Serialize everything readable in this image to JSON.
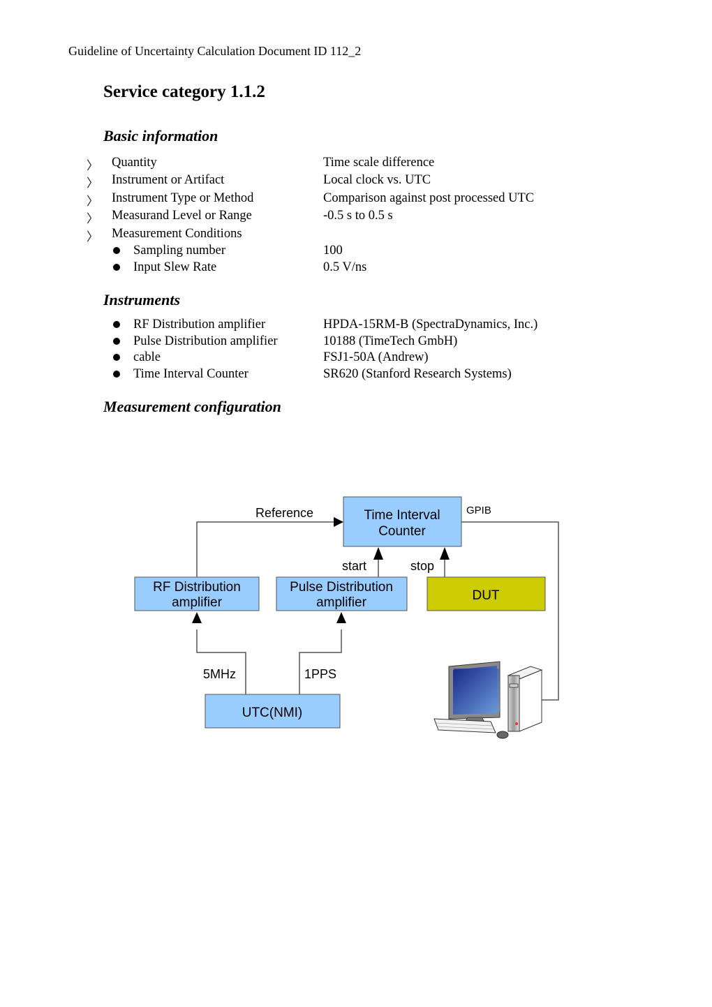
{
  "header": {
    "text": "Guideline of Uncertainty Calculation Document ID 112_2"
  },
  "title": "Service category 1.1.2",
  "basic_information": {
    "heading": "Basic information",
    "items": [
      {
        "label": "Quantity",
        "value": "Time scale difference",
        "marker": "chevron"
      },
      {
        "label": "Instrument or Artifact",
        "value": "Local clock vs. UTC",
        "marker": "chevron"
      },
      {
        "label": "Instrument Type or Method",
        "value": "Comparison against post processed UTC",
        "marker": "chevron"
      },
      {
        "label": "Measurand Level or Range",
        "value": "-0.5 s to 0.5 s",
        "marker": "chevron"
      },
      {
        "label": "Measurement Conditions",
        "value": "",
        "marker": "chevron"
      }
    ],
    "conditions": [
      {
        "label": "Sampling number",
        "value": "100",
        "marker": "bullet"
      },
      {
        "label": "Input Slew Rate",
        "value": "0.5 V/ns",
        "marker": "bullet"
      }
    ]
  },
  "instruments": {
    "heading": "Instruments",
    "items": [
      {
        "label": "RF Distribution amplifier",
        "value": "HPDA-15RM-B (SpectraDynamics, Inc.)"
      },
      {
        "label": "Pulse Distribution amplifier",
        "value": "10188 (TimeTech GmbH)"
      },
      {
        "label": "cable",
        "value": "FSJ1-50A (Andrew)"
      },
      {
        "label": "Time Interval Counter",
        "value": "SR620 (Stanford Research Systems)"
      }
    ]
  },
  "measurement_configuration": {
    "heading": "Measurement configuration",
    "diagram": {
      "colors": {
        "box_blue": "#99ccff",
        "box_dut": "#cccc00",
        "line": "#555555"
      },
      "nodes": {
        "tic": [
          "Time Interval",
          "Counter"
        ],
        "rf": [
          "RF Distribution",
          "amplifier"
        ],
        "pulse": [
          "Pulse Distribution",
          "amplifier"
        ],
        "dut": "DUT",
        "utc": "UTC(NMI)"
      },
      "edge_labels": {
        "reference": "Reference",
        "gpib": "GPIB",
        "start": "start",
        "stop": "stop",
        "mhz": "5MHz",
        "pps": "1PPS"
      }
    }
  }
}
